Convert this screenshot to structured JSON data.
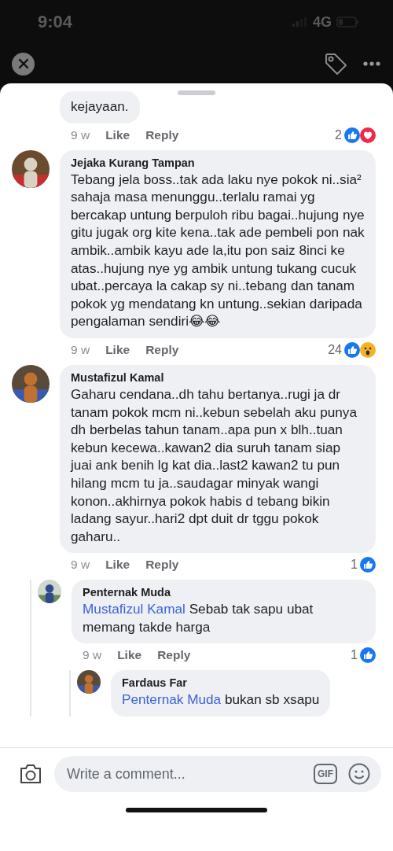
{
  "status_bar": {
    "time": "9:04",
    "network": "4G"
  },
  "comments": [
    {
      "text": "kejayaan.",
      "time": "9 w",
      "like": "Like",
      "reply": "Reply",
      "reaction_count": "2",
      "reactions": [
        {
          "kind": "like"
        },
        {
          "kind": "love"
        }
      ]
    },
    {
      "author": "Jejaka Kurang Tampan",
      "text": "Tebang jela boss..tak ada laku nye pokok ni..sia² sahaja masa menunggu..terlalu ramai yg bercakap untung berpuloh ribu bagai..hujung nye gitu jugak org kite kena..tak ade pembeli pon nak ambik..ambik kayu ade la,itu pon saiz 8inci ke atas..hujung nye yg ambik untung tukang cucuk ubat..percaya la cakap sy ni..tebang dan tanam pokok yg mendatang kn untung..sekian daripada pengalaman sendiri😂😂",
      "time": "9 w",
      "like": "Like",
      "reply": "Reply",
      "reaction_count": "24",
      "reactions": [
        {
          "kind": "like"
        },
        {
          "kind": "wow"
        }
      ]
    },
    {
      "author": "Mustafizul Kamal",
      "text": "Gaharu cendana..dh tahu bertanya..rugi ja dr tanam pokok mcm ni..kebun sebelah aku punya dh berbelas tahun tanam..apa pun x blh..tuan kebun kecewa..kawan2 dia suruh tanam siap juai ank benih lg kat dia..last2 kawan2 tu pun hilang mcm tu ja..saudagar minyak wangi konon..akhirnya pokok habis d tebang bikin ladang sayur..hari2 dpt duit dr tggu pokok gaharu..",
      "time": "9 w",
      "like": "Like",
      "reply": "Reply",
      "reaction_count": "1",
      "reactions": [
        {
          "kind": "like"
        }
      ],
      "replies": [
        {
          "author": "Penternak Muda",
          "mention": "Mustafizul Kamal",
          "text": "Sebab tak sapu ubat memang takde harga",
          "time": "9 w",
          "like": "Like",
          "reply": "Reply",
          "reaction_count": "1",
          "reactions": [
            {
              "kind": "like"
            }
          ],
          "replies": [
            {
              "author": "Fardaus Far",
              "mention": "Penternak Muda",
              "text": "bukan sb xsapu"
            }
          ]
        }
      ]
    }
  ],
  "composer": {
    "placeholder": "Write a comment...",
    "gif": "GIF"
  }
}
